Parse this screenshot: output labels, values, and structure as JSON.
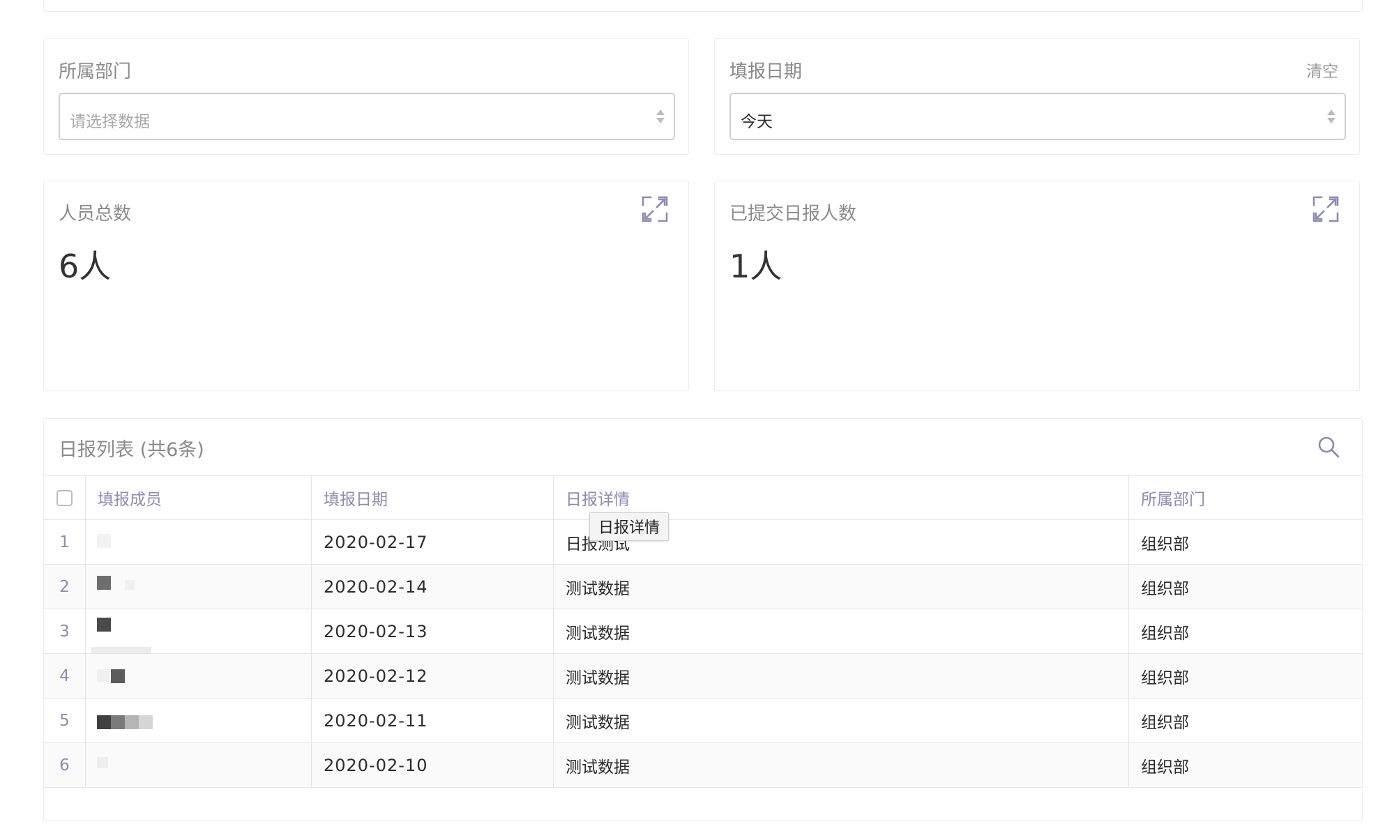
{
  "filters": {
    "department": {
      "label": "所属部门",
      "placeholder": "请选择数据"
    },
    "date": {
      "label": "填报日期",
      "value": "今天",
      "clear_label": "清空"
    }
  },
  "stats": {
    "total": {
      "label": "人员总数",
      "value": "6人"
    },
    "submitted": {
      "label": "已提交日报人数",
      "value": "1人"
    }
  },
  "report_list": {
    "title": "日报列表 (共6条)",
    "columns": [
      "填报成员",
      "填报日期",
      "日报详情",
      "所属部门"
    ],
    "rows": [
      {
        "index": "1",
        "date": "2020-02-17",
        "detail": "日报测试",
        "department": "组织部"
      },
      {
        "index": "2",
        "date": "2020-02-14",
        "detail": "测试数据",
        "department": "组织部"
      },
      {
        "index": "3",
        "date": "2020-02-13",
        "detail": "测试数据",
        "department": "组织部"
      },
      {
        "index": "4",
        "date": "2020-02-12",
        "detail": "测试数据",
        "department": "组织部"
      },
      {
        "index": "5",
        "date": "2020-02-11",
        "detail": "测试数据",
        "department": "组织部"
      },
      {
        "index": "6",
        "date": "2020-02-10",
        "detail": "测试数据",
        "department": "组织部"
      }
    ]
  },
  "tooltip": {
    "text": "日报详情"
  },
  "icons": {
    "expand": "expand-icon",
    "search": "search-icon"
  },
  "colors": {
    "header_text": "#8f8ab5",
    "label_text": "#8a8a8a",
    "border": "#e4e4e4"
  }
}
